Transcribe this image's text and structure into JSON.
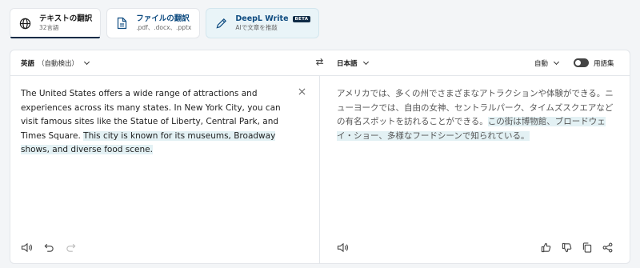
{
  "tabs": [
    {
      "title": "テキストの翻訳",
      "subtitle": "32言語"
    },
    {
      "title": "ファイルの翻訳",
      "subtitle": ".pdf、.docx、.pptx"
    },
    {
      "title": "DeepL Write",
      "badge": "BETA",
      "subtitle": "AIで文章を推敲"
    }
  ],
  "source": {
    "language": "英語",
    "detect": "（自動検出）",
    "text_plain": "The United States offers a wide range of attractions and experiences across its many states. In New York City, you can visit famous sites like the Statue of Liberty, Central Park, and Times Square. ",
    "text_highlight": "This city is known for its museums, Broadway shows, and diverse food scene."
  },
  "target": {
    "language": "日本語",
    "formality": "自動",
    "glossary": "用語集",
    "text_plain": "アメリカでは、多くの州でさまざまなアトラクションや体験ができる。ニューヨークでは、自由の女神、セントラルパーク、タイムズスクエアなどの有名スポットを訪れることができる。",
    "text_highlight": "この街は博物館、ブロードウェイ・ショー、多様なフードシーンで知られている。"
  }
}
